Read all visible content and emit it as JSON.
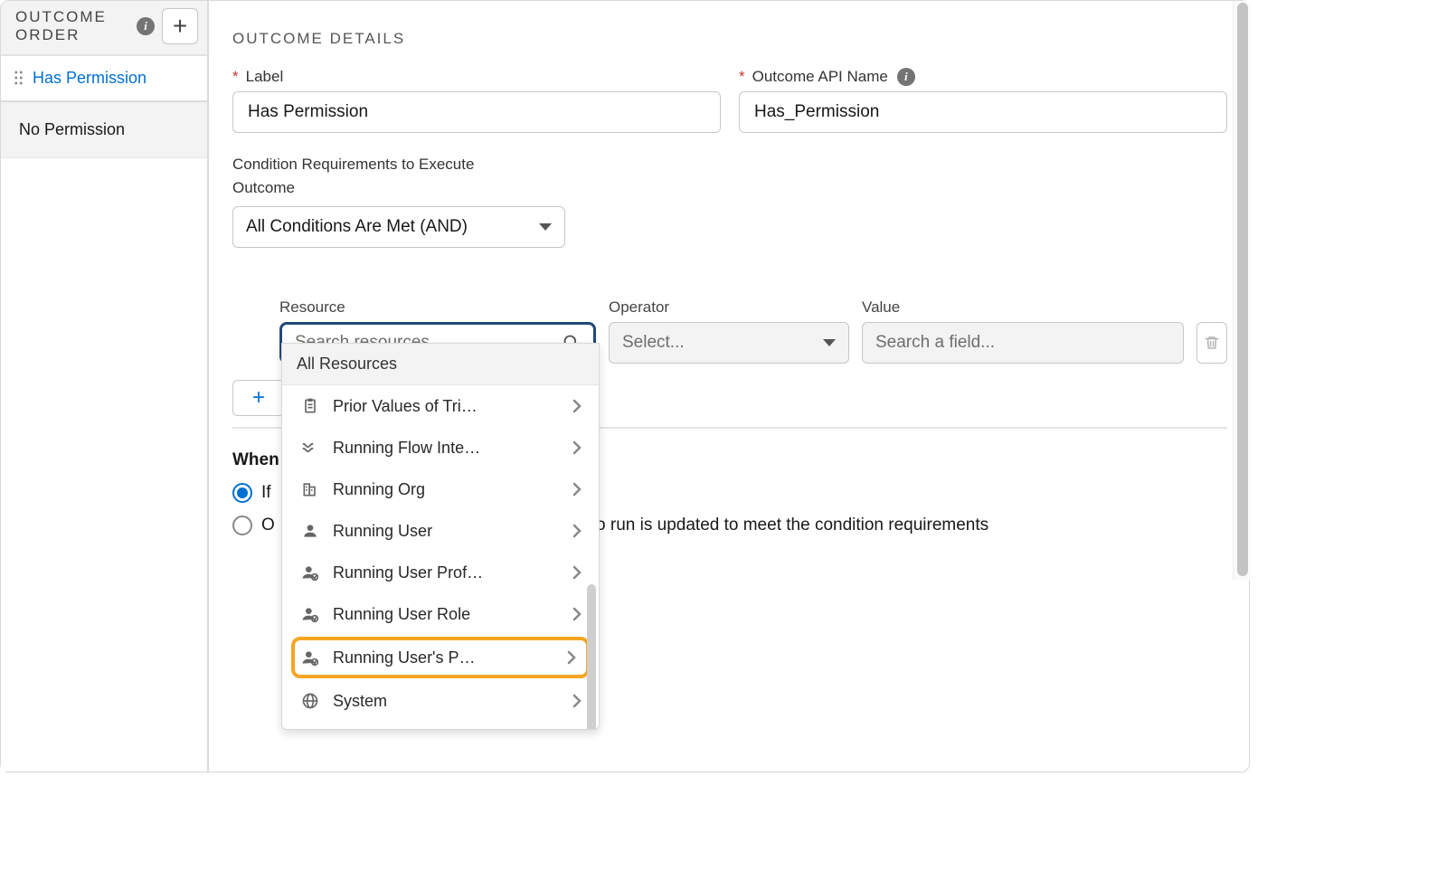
{
  "sidebar": {
    "title": "OUTCOME ORDER",
    "items": [
      {
        "label": "Has Permission",
        "active": true
      },
      {
        "label": "No Permission",
        "active": false
      }
    ]
  },
  "main": {
    "section_title": "OUTCOME DETAILS",
    "label_field": {
      "label": "Label",
      "value": "Has Permission"
    },
    "api_name_field": {
      "label": "Outcome API Name",
      "value": "Has_Permission"
    },
    "cond_req_label": "Condition Requirements to Execute Outcome",
    "cond_req_value": "All Conditions Are Met (AND)",
    "columns": {
      "resource": "Resource",
      "operator": "Operator",
      "value": "Value"
    },
    "resource_placeholder": "Search resources...",
    "operator_placeholder": "Select...",
    "value_placeholder": "Search a field...",
    "when_title": "When",
    "radio1": "If",
    "radio2": "O",
    "radio2_tail": "to run is updated to meet the condition requirements"
  },
  "dropdown": {
    "header": "All Resources",
    "items": [
      {
        "label": "Prior Values of Tri…",
        "icon": "clipboard"
      },
      {
        "label": "Running Flow Inte…",
        "icon": "flow"
      },
      {
        "label": "Running Org",
        "icon": "org"
      },
      {
        "label": "Running User",
        "icon": "user"
      },
      {
        "label": "Running User Prof…",
        "icon": "user-check"
      },
      {
        "label": "Running User Role",
        "icon": "user-check"
      },
      {
        "label": "Running User's P…",
        "icon": "user-check",
        "highlight": true
      },
      {
        "label": "System",
        "icon": "globe"
      }
    ]
  }
}
